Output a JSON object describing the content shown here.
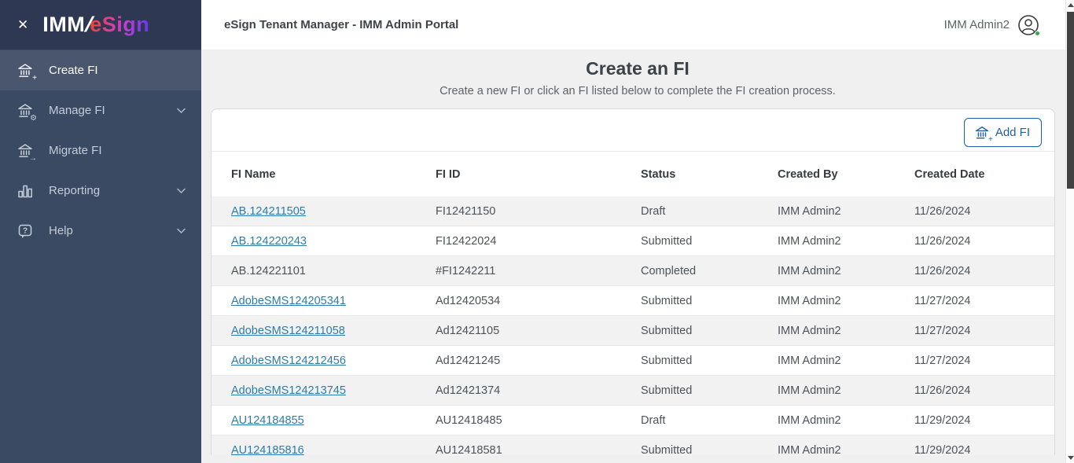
{
  "brand": {
    "imm": "IMM",
    "slash": "/",
    "esign": "eSign",
    "close_icon": "close"
  },
  "sidebar": {
    "items": [
      {
        "label": "Create FI",
        "icon": "bank-plus-icon",
        "active": true,
        "chevron": false
      },
      {
        "label": "Manage FI",
        "icon": "bank-gear-icon",
        "active": false,
        "chevron": true
      },
      {
        "label": "Migrate FI",
        "icon": "bank-arrow-icon",
        "active": false,
        "chevron": false
      },
      {
        "label": "Reporting",
        "icon": "bar-chart-icon",
        "active": false,
        "chevron": true
      },
      {
        "label": "Help",
        "icon": "help-bubble-icon",
        "active": false,
        "chevron": true
      }
    ]
  },
  "header": {
    "title": "eSign Tenant Manager - IMM Admin Portal",
    "user_name": "IMM Admin2"
  },
  "main": {
    "title": "Create an FI",
    "subtitle": "Create a new FI or click an FI listed below to complete the FI creation process.",
    "add_button_label": "Add FI"
  },
  "table": {
    "columns": [
      "FI Name",
      "FI ID",
      "Status",
      "Created By",
      "Created Date"
    ],
    "rows": [
      {
        "fi_name": "AB.124211505",
        "is_link": true,
        "fi_id": "FI12421150",
        "status": "Draft",
        "created_by": "IMM Admin2",
        "created_date": "11/26/2024"
      },
      {
        "fi_name": "AB.124220243",
        "is_link": true,
        "fi_id": "FI12422024",
        "status": "Submitted",
        "created_by": "IMM Admin2",
        "created_date": "11/26/2024"
      },
      {
        "fi_name": "AB.124221101",
        "is_link": false,
        "fi_id": "#FI1242211",
        "status": "Completed",
        "created_by": "IMM Admin2",
        "created_date": "11/26/2024"
      },
      {
        "fi_name": "AdobeSMS124205341",
        "is_link": true,
        "fi_id": "Ad12420534",
        "status": "Submitted",
        "created_by": "IMM Admin2",
        "created_date": "11/27/2024"
      },
      {
        "fi_name": "AdobeSMS124211058",
        "is_link": true,
        "fi_id": "Ad12421105",
        "status": "Submitted",
        "created_by": "IMM Admin2",
        "created_date": "11/27/2024"
      },
      {
        "fi_name": "AdobeSMS124212456",
        "is_link": true,
        "fi_id": "Ad12421245",
        "status": "Submitted",
        "created_by": "IMM Admin2",
        "created_date": "11/27/2024"
      },
      {
        "fi_name": "AdobeSMS124213745",
        "is_link": true,
        "fi_id": "Ad12421374",
        "status": "Submitted",
        "created_by": "IMM Admin2",
        "created_date": "11/26/2024"
      },
      {
        "fi_name": "AU124184855",
        "is_link": true,
        "fi_id": "AU12418485",
        "status": "Draft",
        "created_by": "IMM Admin2",
        "created_date": "11/29/2024"
      },
      {
        "fi_name": "AU124185816",
        "is_link": true,
        "fi_id": "AU12418581",
        "status": "Submitted",
        "created_by": "IMM Admin2",
        "created_date": "11/29/2024"
      }
    ]
  },
  "colors": {
    "sidebar_bg": "#3b4a63",
    "logo_bar_bg": "#2e3852",
    "active_item_bg": "#4a566e",
    "accent_blue": "#1d5fa9",
    "link_blue": "#2b7cab",
    "alt_row_bg": "#f2f2f2",
    "presence_green": "#34a84c",
    "logo_gradient_start": "#ef4438",
    "logo_gradient_end": "#6a3aee"
  }
}
